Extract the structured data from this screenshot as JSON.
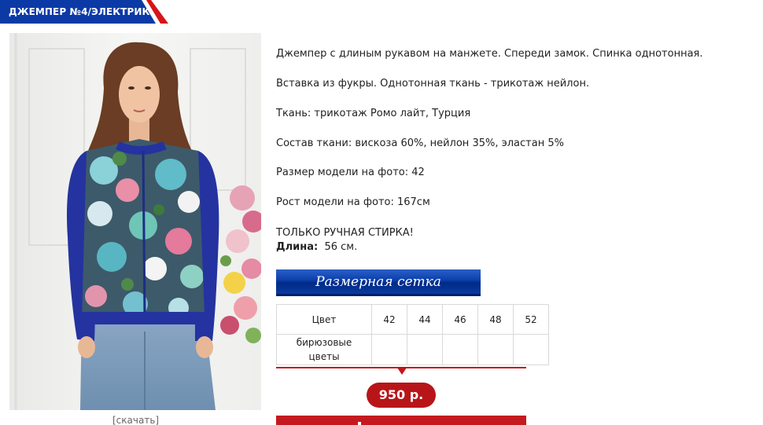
{
  "product": {
    "title": "ДЖЕМПЕР №4/ЭЛЕКТРИК",
    "download_link": "[скачать]",
    "description": [
      "Джемпер с длиным рукавом на манжете. Спереди замок. Спинка однотонная.",
      "Вставка из фукры. Однотонная ткань - трикотаж нейлон.",
      "Ткань: трикотаж Ромо лайт, Турция",
      "Состав ткани: вискоза 60%, нейлон 35%, эластан 5%",
      "Размер модели на фото: 42",
      "Рост модели на фото: 167см",
      "ТОЛЬКО РУЧНАЯ СТИРКА!"
    ],
    "length_label": "Длина:",
    "length_value": "56 см."
  },
  "size_chart": {
    "button_label": "Размерная сетка",
    "header_label": "Цвет",
    "sizes": [
      "42",
      "44",
      "46",
      "48",
      "52"
    ],
    "rows": [
      {
        "color_line1": "бирюзовые",
        "color_line2": "цветы",
        "cells": [
          "",
          "",
          "",
          "",
          ""
        ]
      }
    ]
  },
  "price": {
    "value": "950 р."
  },
  "colors": {
    "title_tab": "#0b3aa6",
    "title_tab_accent": "#d7141a",
    "size_button": "#0b3ea8",
    "price_badge": "#b81519",
    "jumper_blue": "#2433a0"
  },
  "icons": {
    "photo": "product-photo-image"
  }
}
